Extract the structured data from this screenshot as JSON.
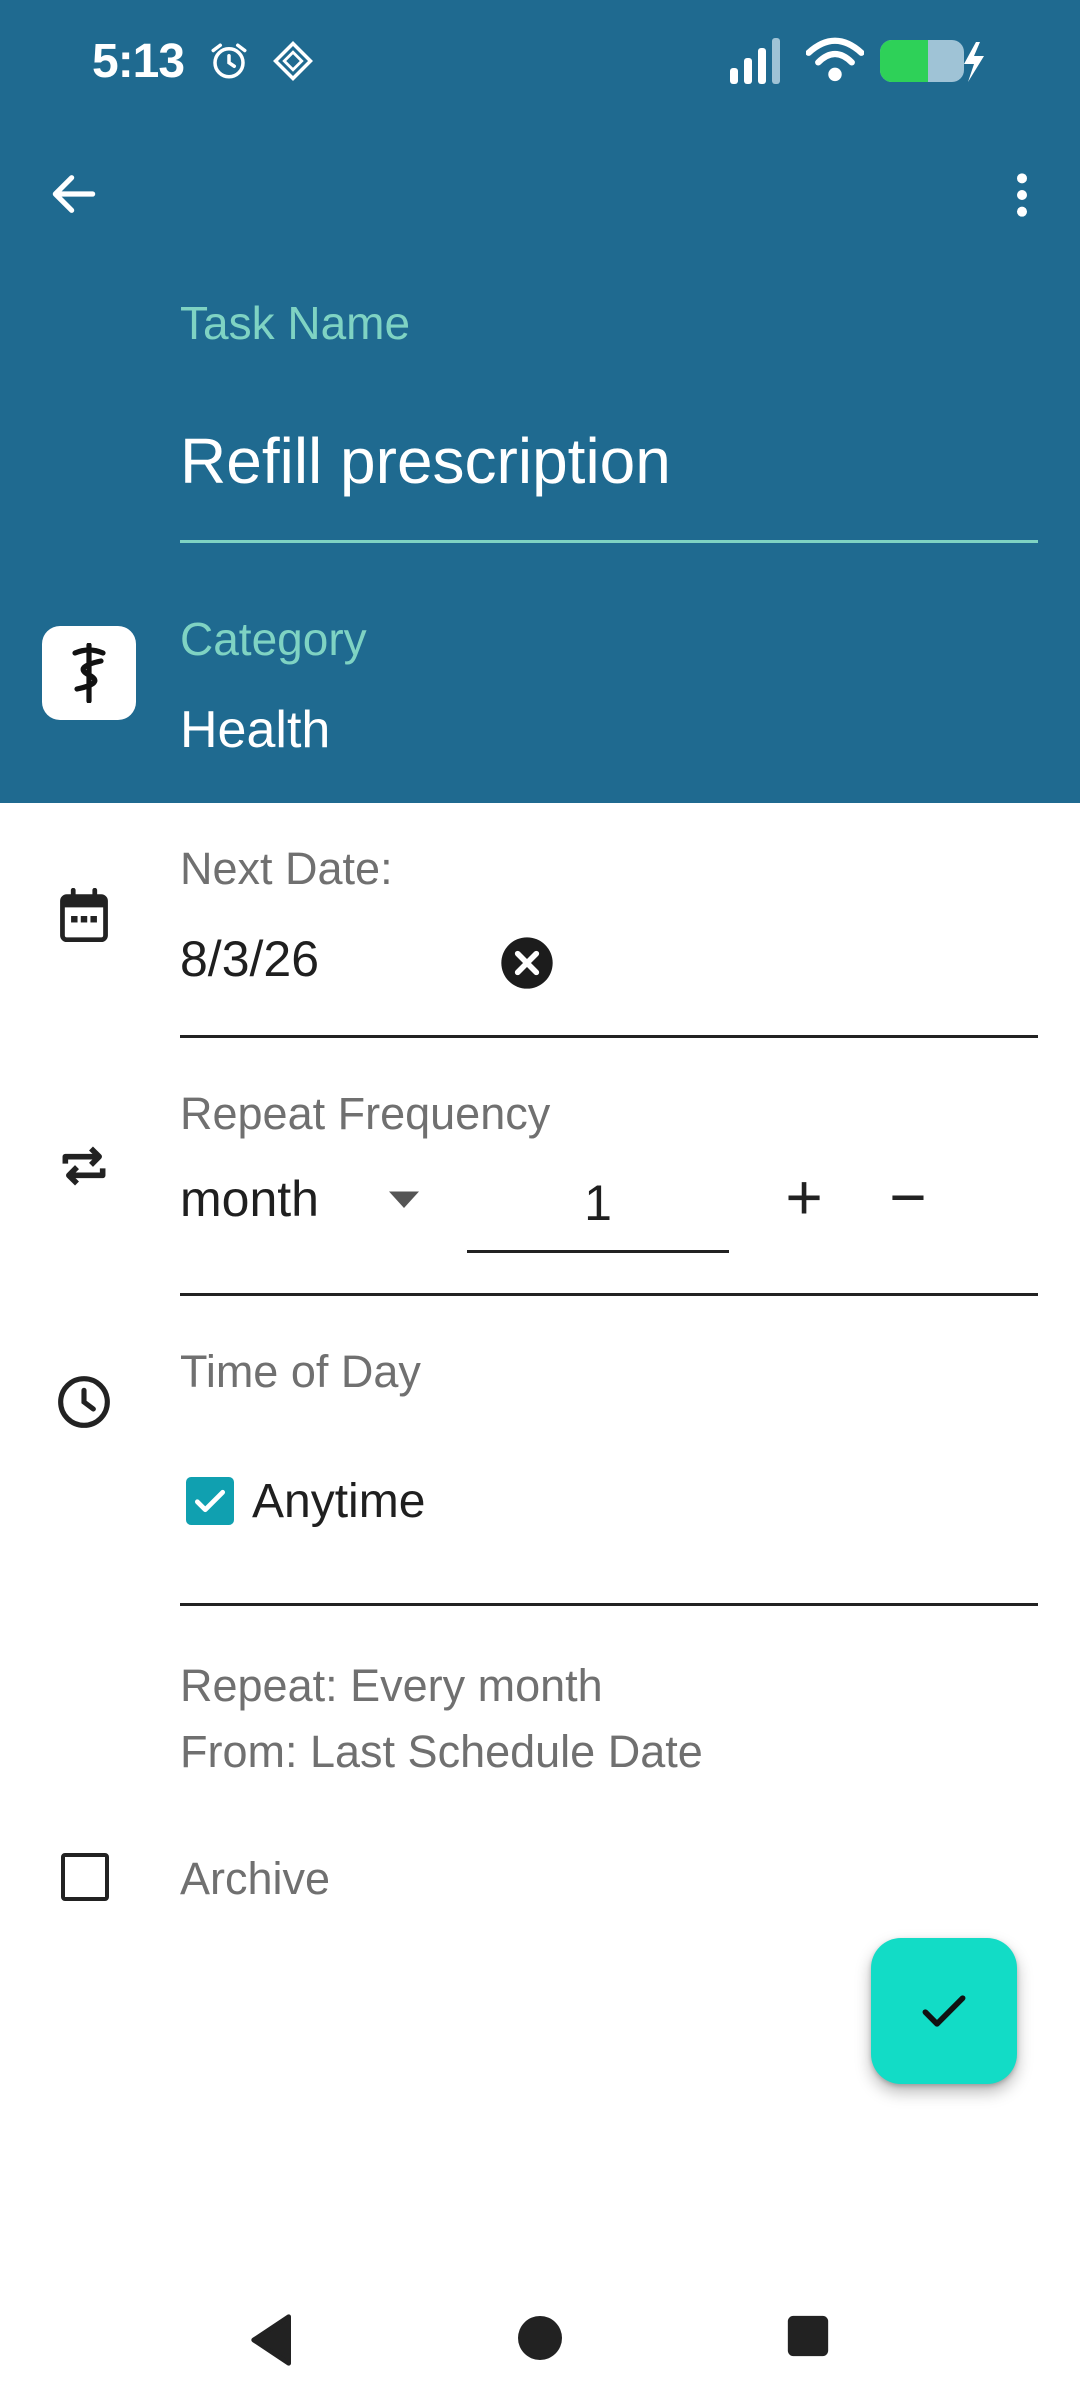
{
  "status_bar": {
    "time": "5:13",
    "icons": [
      "alarm-icon",
      "app-notification-icon",
      "signal-icon",
      "wifi-icon",
      "battery-charging-icon"
    ]
  },
  "toolbar": {
    "back_icon": "arrow-left-icon",
    "menu_icon": "more-vertical-icon"
  },
  "task": {
    "name_label": "Task Name",
    "name_value": "Refill prescription"
  },
  "category": {
    "label": "Category",
    "value": "Health",
    "icon": "caduceus-icon"
  },
  "next_date": {
    "label": "Next Date:",
    "value": "8/3/26",
    "clear_icon": "clear-circle-icon",
    "icon": "calendar-icon"
  },
  "repeat": {
    "label": "Repeat Frequency",
    "unit": "month",
    "count": "1",
    "increment_label": "+",
    "decrement_label": "−",
    "icon": "repeat-icon"
  },
  "time_of_day": {
    "label": "Time of Day",
    "anytime_label": "Anytime",
    "anytime_checked": true,
    "icon": "clock-icon"
  },
  "summary": {
    "line1": "Repeat: Every month",
    "line2": "From: Last Schedule Date"
  },
  "archive": {
    "label": "Archive",
    "checked": false
  },
  "colors": {
    "header": "#1f6a90",
    "accent_teal": "#7fd3c3",
    "fab": "#12dcc6",
    "checkbox": "#10a0b0"
  }
}
